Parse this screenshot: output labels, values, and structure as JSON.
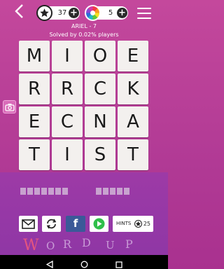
{
  "header": {
    "back_icon": "chevron-left-icon",
    "stars_count": "37",
    "coins_count": "5",
    "plus_label": "+",
    "menu_icon": "hamburger-icon"
  },
  "level_title": "ARIEL - 7",
  "solved_text": "Solved by 0.02% players",
  "grid": [
    [
      "M",
      "I",
      "O",
      "E"
    ],
    [
      "R",
      "R",
      "C",
      "K"
    ],
    [
      "E",
      "C",
      "N",
      "A"
    ],
    [
      "T",
      "I",
      "S",
      "T"
    ]
  ],
  "answer_slots": {
    "first_word_length": 7,
    "second_word_length": 5
  },
  "buttons": {
    "mail_icon": "envelope-icon",
    "refresh_icon": "refresh-icon",
    "facebook_label": "f",
    "play_icon": "play-icon",
    "hints_label": "HINTS",
    "hints_count": "25"
  },
  "branding": [
    "W",
    "O",
    "R",
    "D",
    "U",
    "P"
  ],
  "colors": {
    "background": "#b13a95",
    "tile": "#f3f0ee",
    "facebook": "#3b5998",
    "play": "#2fbf4a"
  }
}
